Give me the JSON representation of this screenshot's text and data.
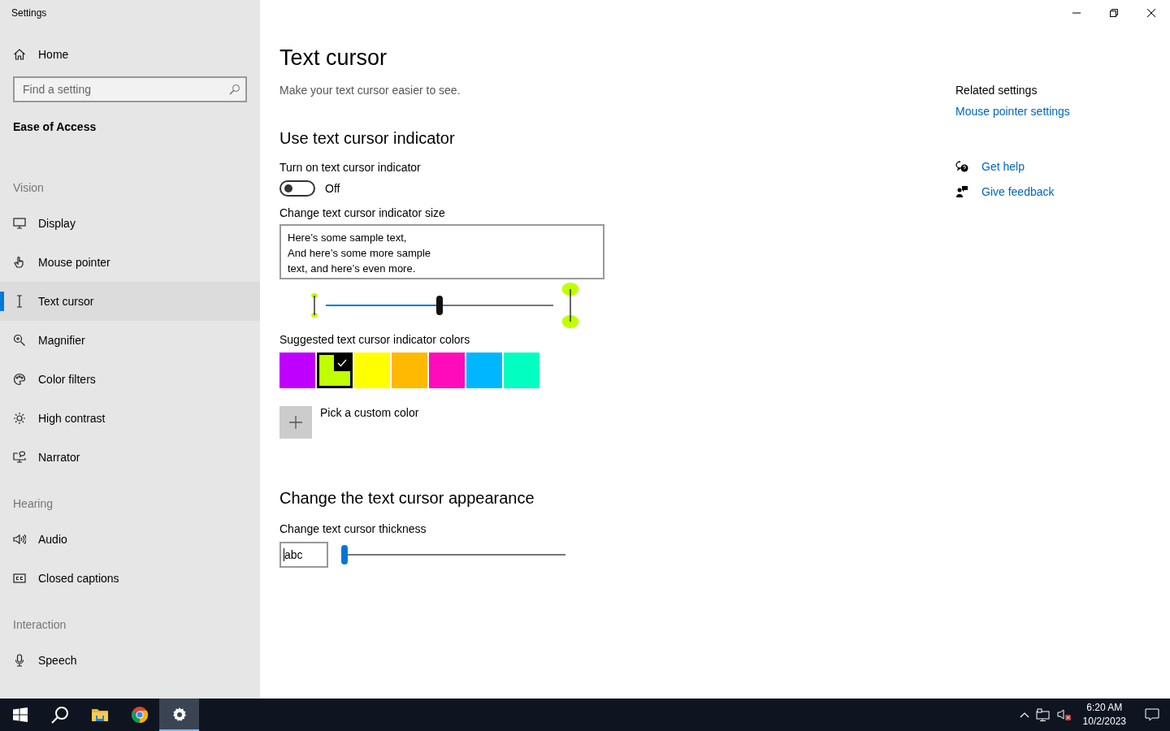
{
  "window": {
    "title": "Settings"
  },
  "sidebar": {
    "home": "Home",
    "search": {
      "placeholder": "Find a setting"
    },
    "section": "Ease of Access",
    "groups": [
      {
        "heading": "Vision",
        "items": [
          {
            "label": "Display",
            "selected": false
          },
          {
            "label": "Mouse pointer",
            "selected": false
          },
          {
            "label": "Text cursor",
            "selected": true
          },
          {
            "label": "Magnifier",
            "selected": false
          },
          {
            "label": "Color filters",
            "selected": false
          },
          {
            "label": "High contrast",
            "selected": false
          },
          {
            "label": "Narrator",
            "selected": false
          }
        ]
      },
      {
        "heading": "Hearing",
        "items": [
          {
            "label": "Audio",
            "selected": false
          },
          {
            "label": "Closed captions",
            "selected": false
          }
        ]
      },
      {
        "heading": "Interaction",
        "items": [
          {
            "label": "Speech",
            "selected": false
          }
        ]
      }
    ]
  },
  "main": {
    "title": "Text cursor",
    "subtitle": "Make your text cursor easier to see.",
    "indicator_heading": "Use text cursor indicator",
    "toggle": {
      "label": "Turn on text cursor indicator",
      "on": false,
      "state_text": "Off"
    },
    "size": {
      "label": "Change text cursor indicator size",
      "sample_lines": [
        "Here’s some sample text,",
        "And here’s some more sample",
        "text, and here’s even more."
      ],
      "level": 0.5
    },
    "colors": {
      "label": "Suggested text cursor indicator colors",
      "swatches": [
        {
          "color": "#bf00ff",
          "selected": false
        },
        {
          "color": "#c0ff00",
          "selected": true
        },
        {
          "color": "#ffff00",
          "selected": false
        },
        {
          "color": "#ffb900",
          "selected": false
        },
        {
          "color": "#ff0bbb",
          "selected": false
        },
        {
          "color": "#00b7ff",
          "selected": false
        },
        {
          "color": "#00ffc0",
          "selected": false
        }
      ]
    },
    "custom_color": "Pick a custom color",
    "appearance_heading": "Change the text cursor appearance",
    "thickness": {
      "label": "Change text cursor thickness",
      "preview": "abc",
      "level": 0
    }
  },
  "related": {
    "heading": "Related settings",
    "link": "Mouse pointer settings",
    "help": [
      "Get help",
      "Give feedback"
    ]
  },
  "taskbar": {
    "apps": [
      {
        "selected": false
      },
      {
        "selected": false
      },
      {
        "selected": false
      },
      {
        "selected": true
      }
    ],
    "time": "6:20 AM",
    "date": "10/2/2023"
  }
}
